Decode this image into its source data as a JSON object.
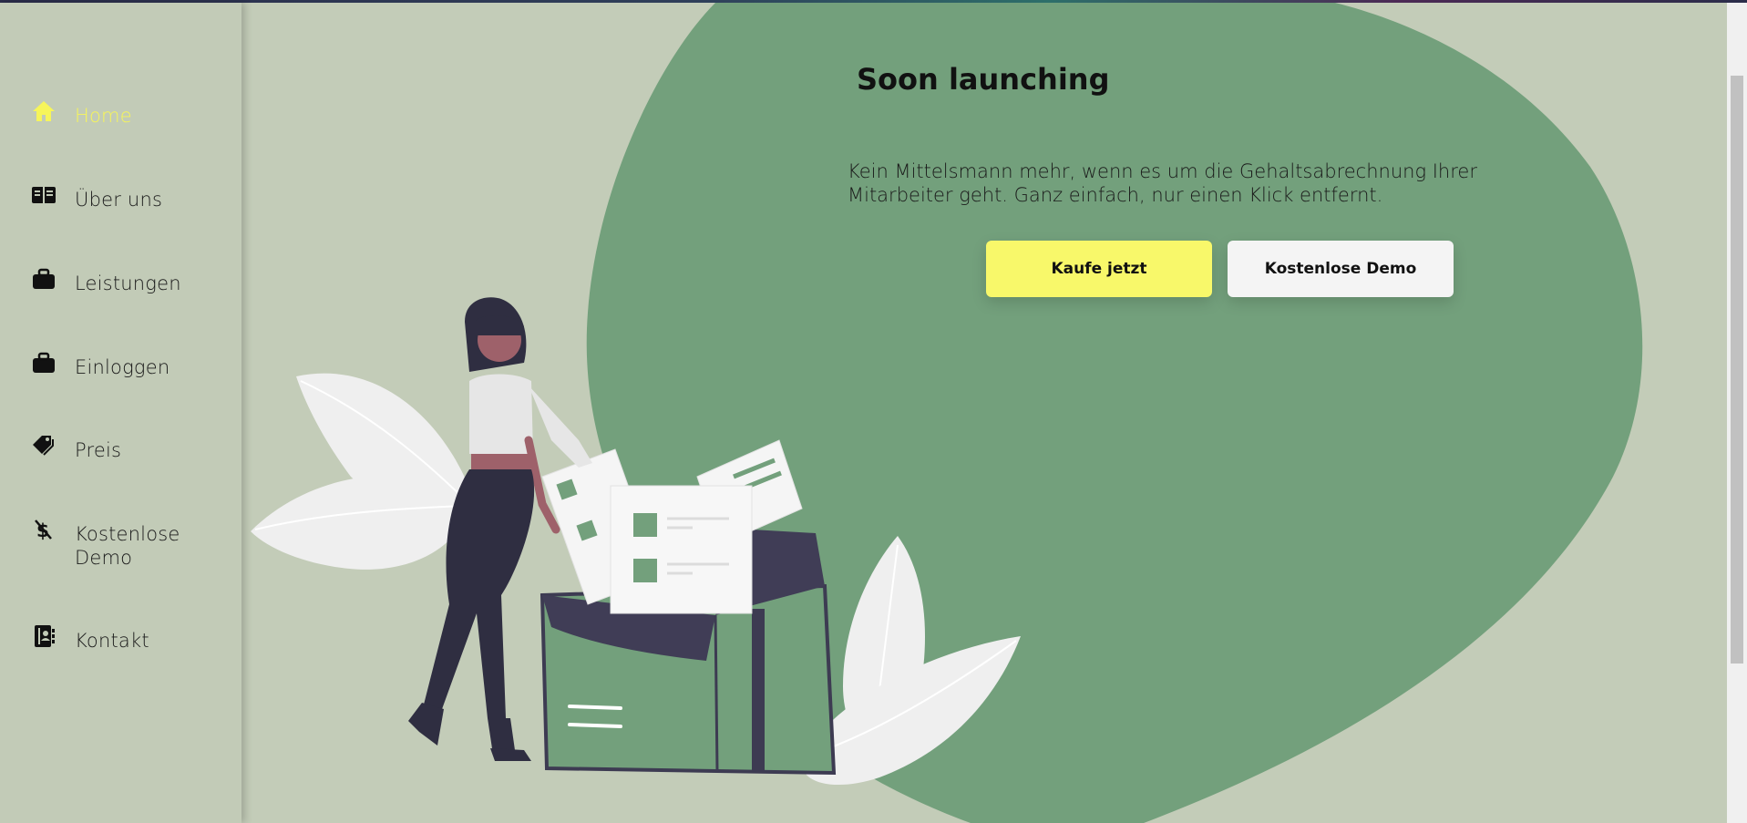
{
  "sidebar": {
    "items": [
      {
        "label": "Home",
        "icon": "home-icon",
        "active": true
      },
      {
        "label": "Über uns",
        "icon": "book-icon"
      },
      {
        "label": "Leistungen",
        "icon": "briefcase-icon"
      },
      {
        "label": "Einloggen",
        "icon": "briefcase-icon"
      },
      {
        "label": "Preis",
        "icon": "tags-icon"
      },
      {
        "label": "Kostenlose Demo",
        "icon": "dollar-off-icon"
      },
      {
        "label": "Kontakt",
        "icon": "address-book-icon"
      }
    ]
  },
  "hero": {
    "title": "Soon launching",
    "description": "Kein Mittelsmann mehr, wenn es um die Gehaltsabrechnung Ihrer Mitarbeiter geht. Ganz einfach, nur einen Klick entfernt.",
    "buy_label": "Kaufe jetzt",
    "demo_label": "Kostenlose Demo"
  },
  "colors": {
    "background": "#c3ccb8",
    "blob": "#73a07c",
    "active_nav": "#f6f55a",
    "button_primary": "#f8f86a",
    "button_secondary": "#f4f4f4"
  }
}
